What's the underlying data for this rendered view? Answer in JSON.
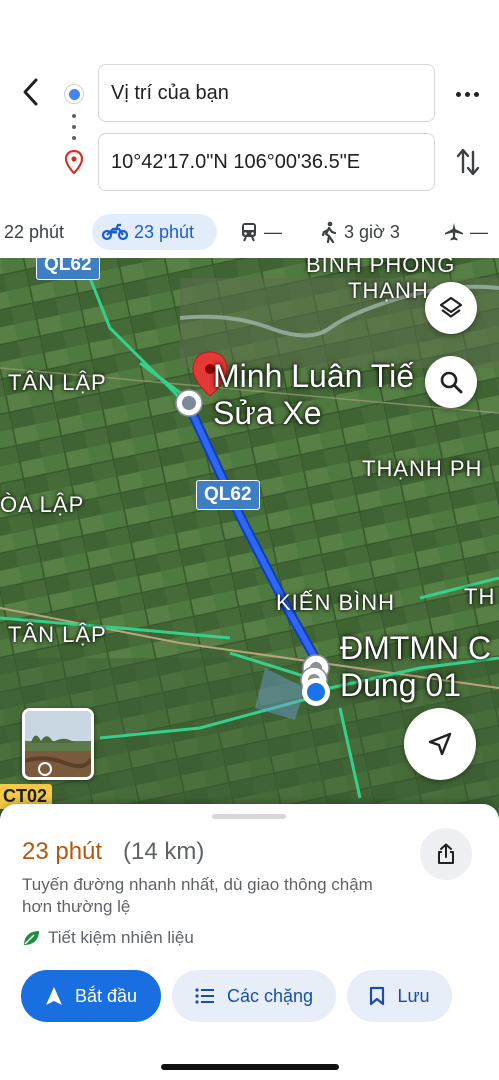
{
  "search": {
    "origin_value": "Vị trí của bạn",
    "destination_value": "10°42'17.0\"N 106°00'36.5\"E"
  },
  "icons": {
    "back": "back-arrow-icon",
    "more": "more-dots-icon",
    "swap": "swap-icon",
    "layers": "layers-icon",
    "search": "search-icon",
    "navigate": "navigation-arrow-icon"
  },
  "travel_modes": [
    {
      "mode": "car",
      "label": "22 phút",
      "selected": false
    },
    {
      "mode": "motorbike",
      "label": "23 phút",
      "selected": true
    },
    {
      "mode": "transit",
      "label": "—",
      "selected": false
    },
    {
      "mode": "walk",
      "label": "3 giờ 3",
      "selected": false
    },
    {
      "mode": "flight",
      "label": "—",
      "selected": false
    }
  ],
  "map": {
    "labels": {
      "ql62_top": "QL62",
      "binh_phong_thanh": "BÌNH PHONG",
      "thanh": "THẠNH",
      "tan_lap_1": "TÂN LẬP",
      "thanh_phu": "THẠNH PH",
      "hoa_lap": "ÒA LẬP",
      "kien_binh": "KIẾN BÌNH",
      "tan_lap_2": "TÂN LẬP",
      "th_right": "TH",
      "ct02": "CT02",
      "road_ql62": "QL62"
    },
    "poi_1_line1": "Minh Luân Tiế",
    "poi_1_line2": "Sửa Xe",
    "poi_2_line1": "ĐMTMN C",
    "poi_2_line2": "Dung 01"
  },
  "route_summary": {
    "duration": "23 phút",
    "distance": "(14 km)",
    "description": "Tuyến đường nhanh nhất, dù giao thông chậm hơn thường lệ",
    "eco_label": "Tiết kiệm nhiên liệu"
  },
  "actions": {
    "start": "Bắt đầu",
    "steps": "Các chặng",
    "save": "Lưu"
  },
  "colors": {
    "accent": "#1a6fe0",
    "route": "#1a4fe0",
    "duration": "#b3580a",
    "selected_mode_bg": "#e2ecfb"
  }
}
